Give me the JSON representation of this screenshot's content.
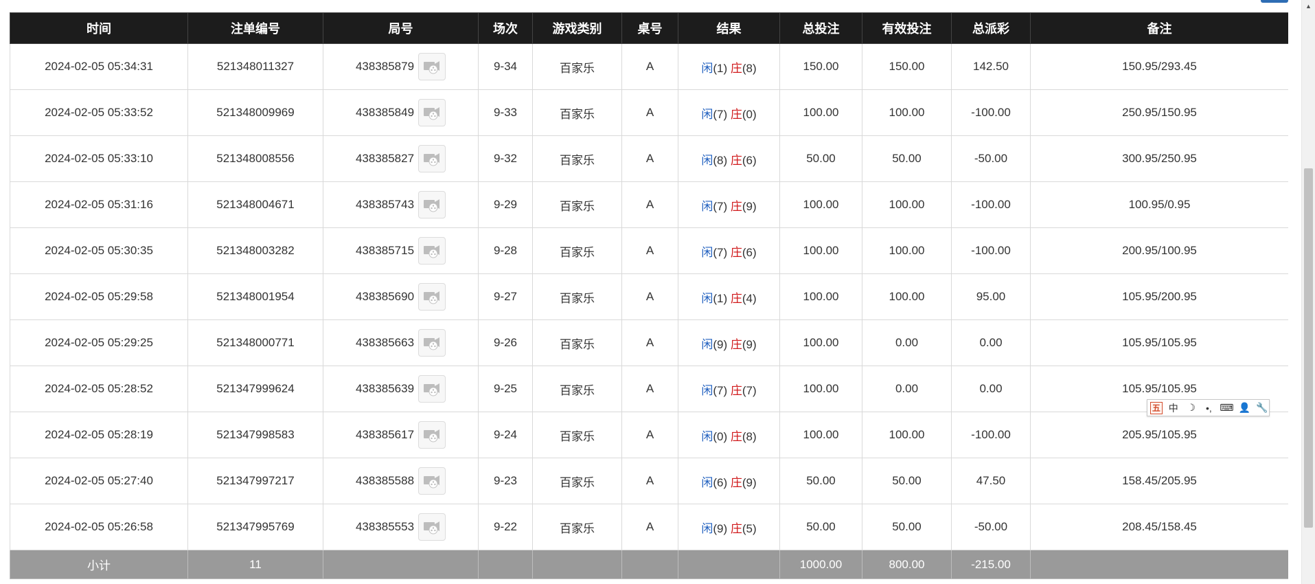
{
  "headers": {
    "time": "时间",
    "order_no": "注单编号",
    "round_no": "局号",
    "session": "场次",
    "game_type": "游戏类别",
    "table_no": "桌号",
    "result": "结果",
    "total_bet": "总投注",
    "valid_bet": "有效投注",
    "total_payout": "总派彩",
    "remark": "备注"
  },
  "labels": {
    "player": "闲",
    "banker": "庄"
  },
  "rows": [
    {
      "time": "2024-02-05 05:34:31",
      "order_no": "521348011327",
      "round_no": "438385879",
      "session": "9-34",
      "game_type": "百家乐",
      "table_no": "A",
      "player_score": "(1)",
      "banker_score": "(8)",
      "total_bet": "150.00",
      "valid_bet": "150.00",
      "total_payout": "142.50",
      "payout_negative": false,
      "remark": "150.95/293.45"
    },
    {
      "time": "2024-02-05 05:33:52",
      "order_no": "521348009969",
      "round_no": "438385849",
      "session": "9-33",
      "game_type": "百家乐",
      "table_no": "A",
      "player_score": "(7)",
      "banker_score": "(0)",
      "total_bet": "100.00",
      "valid_bet": "100.00",
      "total_payout": "-100.00",
      "payout_negative": true,
      "remark": "250.95/150.95"
    },
    {
      "time": "2024-02-05 05:33:10",
      "order_no": "521348008556",
      "round_no": "438385827",
      "session": "9-32",
      "game_type": "百家乐",
      "table_no": "A",
      "player_score": "(8)",
      "banker_score": "(6)",
      "total_bet": "50.00",
      "valid_bet": "50.00",
      "total_payout": "-50.00",
      "payout_negative": true,
      "remark": "300.95/250.95"
    },
    {
      "time": "2024-02-05 05:31:16",
      "order_no": "521348004671",
      "round_no": "438385743",
      "session": "9-29",
      "game_type": "百家乐",
      "table_no": "A",
      "player_score": "(7)",
      "banker_score": "(9)",
      "total_bet": "100.00",
      "valid_bet": "100.00",
      "total_payout": "-100.00",
      "payout_negative": true,
      "remark": "100.95/0.95"
    },
    {
      "time": "2024-02-05 05:30:35",
      "order_no": "521348003282",
      "round_no": "438385715",
      "session": "9-28",
      "game_type": "百家乐",
      "table_no": "A",
      "player_score": "(7)",
      "banker_score": "(6)",
      "total_bet": "100.00",
      "valid_bet": "100.00",
      "total_payout": "-100.00",
      "payout_negative": true,
      "remark": "200.95/100.95"
    },
    {
      "time": "2024-02-05 05:29:58",
      "order_no": "521348001954",
      "round_no": "438385690",
      "session": "9-27",
      "game_type": "百家乐",
      "table_no": "A",
      "player_score": "(1)",
      "banker_score": "(4)",
      "total_bet": "100.00",
      "valid_bet": "100.00",
      "total_payout": "95.00",
      "payout_negative": false,
      "remark": "105.95/200.95"
    },
    {
      "time": "2024-02-05 05:29:25",
      "order_no": "521348000771",
      "round_no": "438385663",
      "session": "9-26",
      "game_type": "百家乐",
      "table_no": "A",
      "player_score": "(9)",
      "banker_score": "(9)",
      "total_bet": "100.00",
      "valid_bet": "0.00",
      "total_payout": "0.00",
      "payout_negative": false,
      "remark": "105.95/105.95"
    },
    {
      "time": "2024-02-05 05:28:52",
      "order_no": "521347999624",
      "round_no": "438385639",
      "session": "9-25",
      "game_type": "百家乐",
      "table_no": "A",
      "player_score": "(7)",
      "banker_score": "(7)",
      "total_bet": "100.00",
      "valid_bet": "0.00",
      "total_payout": "0.00",
      "payout_negative": false,
      "remark": "105.95/105.95"
    },
    {
      "time": "2024-02-05 05:28:19",
      "order_no": "521347998583",
      "round_no": "438385617",
      "session": "9-24",
      "game_type": "百家乐",
      "table_no": "A",
      "player_score": "(0)",
      "banker_score": "(8)",
      "total_bet": "100.00",
      "valid_bet": "100.00",
      "total_payout": "-100.00",
      "payout_negative": true,
      "remark": "205.95/105.95"
    },
    {
      "time": "2024-02-05 05:27:40",
      "order_no": "521347997217",
      "round_no": "438385588",
      "session": "9-23",
      "game_type": "百家乐",
      "table_no": "A",
      "player_score": "(6)",
      "banker_score": "(9)",
      "total_bet": "50.00",
      "valid_bet": "50.00",
      "total_payout": "47.50",
      "payout_negative": false,
      "remark": "158.45/205.95"
    },
    {
      "time": "2024-02-05 05:26:58",
      "order_no": "521347995769",
      "round_no": "438385553",
      "session": "9-22",
      "game_type": "百家乐",
      "table_no": "A",
      "player_score": "(9)",
      "banker_score": "(5)",
      "total_bet": "50.00",
      "valid_bet": "50.00",
      "total_payout": "-50.00",
      "payout_negative": true,
      "remark": "208.45/158.45"
    }
  ],
  "subtotal": {
    "label": "小计",
    "count": "11",
    "total_bet": "1000.00",
    "valid_bet": "800.00",
    "total_payout": "-215.00"
  },
  "ime_toolbar": {
    "logo": "五",
    "mode": "中",
    "moon": "☽",
    "punct": "•,",
    "keyboard": "⌨",
    "user": "👤",
    "tools": "🔧"
  },
  "icons": {
    "video": "video-replay-icon",
    "scroll_up": "chevron-up-icon"
  },
  "colors": {
    "header_bg": "#1c1c1c",
    "subtotal_bg": "#9a9a9a",
    "player_blue": "#1f5fbf",
    "banker_red": "#d0191b",
    "negative_red": "#d0191b",
    "bet_blue": "#1f5fbf"
  }
}
